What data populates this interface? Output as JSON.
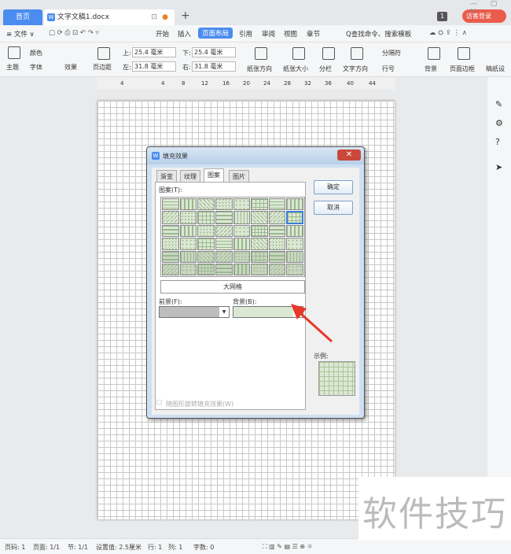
{
  "titlebar": {
    "home_tab": "首页",
    "doc_tab": "文字文稿1.docx",
    "new_tab": "+",
    "badge": "1",
    "guest_login": "访客登录",
    "win_controls": "— ▢ ✕"
  },
  "menubar": {
    "file": "≡ 文件 ∨",
    "items": [
      "开始",
      "插入",
      "页面布局",
      "引用",
      "审阅",
      "视图",
      "章节"
    ],
    "active": "页面布局",
    "search": "Q查找命令、搜索模板"
  },
  "ribbon": {
    "theme": "主题",
    "color": "颜色",
    "font": "字体",
    "effect": "效果",
    "margins": "页边距",
    "top_label": "上:",
    "top_value": "25.4 毫米",
    "bottom_label": "下:",
    "bottom_value": "25.4 毫米",
    "left_label": "左:",
    "left_value": "31.8 毫米",
    "right_label": "右:",
    "right_value": "31.8 毫米",
    "orientation": "纸张方向",
    "size": "纸张大小",
    "columns": "分栏",
    "text_dir": "文字方向",
    "separator": "分隔符",
    "line_no": "行号",
    "background": "背景",
    "border": "页面边框",
    "draft": "稿纸设"
  },
  "ruler": {
    "ticks": [
      "4",
      "4",
      "8",
      "12",
      "16",
      "20",
      "24",
      "28",
      "32",
      "36",
      "40",
      "44"
    ]
  },
  "dialog": {
    "title": "填充效果",
    "tabs": [
      "渐变",
      "纹理",
      "图案",
      "图片"
    ],
    "active_tab": "图案",
    "pattern_label": "图案(T):",
    "selected_pattern": "大网格",
    "foreground_label": "前景(F):",
    "background_label": "背景(B):",
    "ok": "确定",
    "cancel": "取消",
    "sample_label": "示例:",
    "rotate_label": "随图形旋转填充效果(W)"
  },
  "statusbar": {
    "page_no": "页码: 1",
    "pages": "页面: 1/1",
    "section": "节: 1/1",
    "setting": "设置值: 2.5厘米",
    "row": "行: 1",
    "col": "列: 1",
    "words": "字数: 0"
  },
  "watermark": "软件技巧",
  "colors": {
    "accent": "#4a8cf0",
    "guest": "#e95c4b",
    "arrow": "#e8372a",
    "pattern_bg": "#dbe8d4"
  }
}
